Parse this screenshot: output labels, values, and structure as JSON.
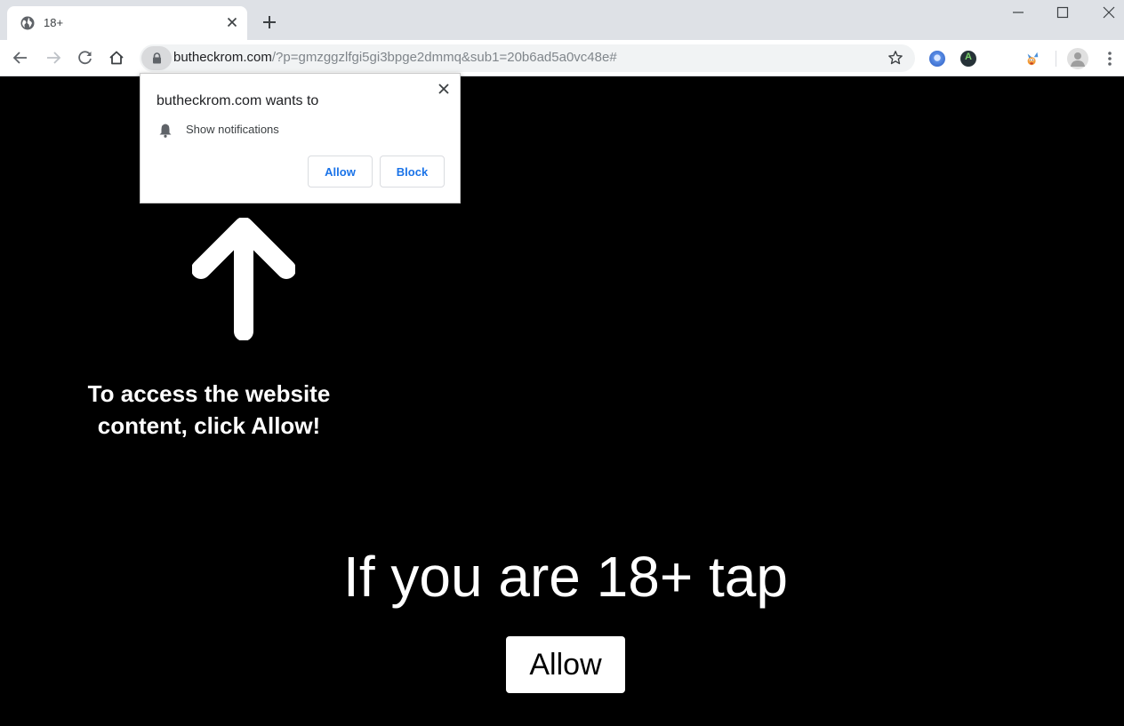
{
  "browser": {
    "tab": {
      "title": "18+",
      "favicon": "globe-icon",
      "close_icon": "close-icon"
    },
    "new_tab_icon": "plus-icon",
    "window_controls": [
      "minimize-icon",
      "maximize-icon",
      "close-icon"
    ],
    "toolbar": {
      "nav_icons": [
        "back-arrow-icon",
        "forward-arrow-icon",
        "reload-icon",
        "home-icon"
      ],
      "security_icon": "lock-icon",
      "url_host": "butheckrom.com",
      "url_rest": "/?p=gmzggzlfgi5gi3bpge2dmmq&sub1=20b6ad5a0vc48e#",
      "bookmark_icon": "star-icon",
      "extensions": [
        "blue-disc-extension-icon",
        "dark-a-extension-icon",
        "cartoon-dog-extension-icon"
      ],
      "profile_icon": "avatar-icon",
      "menu_icon": "kebab-menu-icon"
    }
  },
  "permission_popup": {
    "title": "butheckrom.com wants to",
    "permission_icon": "bell-icon",
    "permission_text": "Show notifications",
    "allow_label": "Allow",
    "block_label": "Block",
    "accent_color": "#1a73e8"
  },
  "page": {
    "arrow_icon": "up-arrow-icon",
    "hint_line1": "To access the website",
    "hint_line2": "content, click Allow!",
    "headline": "If you are 18+ tap",
    "allow_button": "Allow",
    "background_color": "#000000"
  }
}
